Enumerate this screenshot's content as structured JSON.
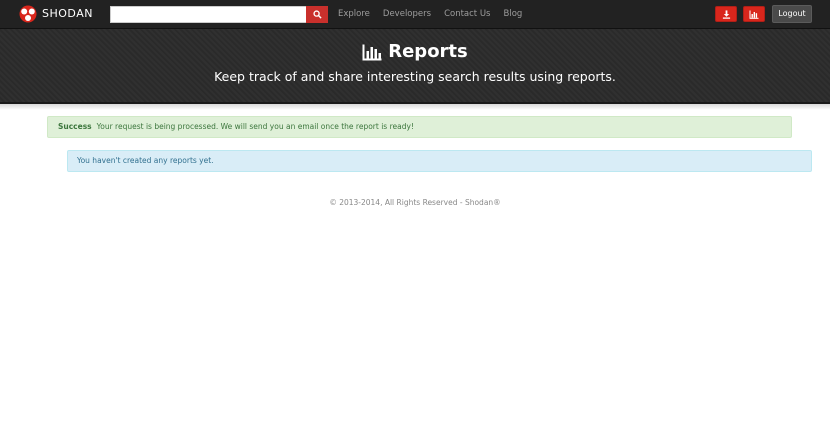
{
  "brand": {
    "name": "Shodan",
    "logo_text": "SHODAN"
  },
  "search": {
    "value": "",
    "placeholder": "",
    "button_icon": "search-icon"
  },
  "nav": {
    "links": [
      {
        "label": "Explore"
      },
      {
        "label": "Developers"
      },
      {
        "label": "Contact Us"
      },
      {
        "label": "Blog"
      }
    ],
    "download_icon": "download-icon",
    "reports_icon": "bar-chart-icon",
    "logout_label": "Logout"
  },
  "header": {
    "title": "Reports",
    "title_icon": "bar-chart-icon",
    "subtitle": "Keep track of and share interesting search results using reports."
  },
  "alerts": {
    "success_label": "Success",
    "success_message": "Your request is being processed. We will send you an email once the report is ready!",
    "info_message": "You haven't created any reports yet."
  },
  "footer": {
    "text": "© 2013-2014, All Rights Reserved - Shodan®"
  },
  "colors": {
    "navbar": "#222222",
    "accent_red": "#d9261c",
    "banner": "#2b2b2b",
    "success_bg": "#dff0d8",
    "info_bg": "#d9edf7"
  }
}
